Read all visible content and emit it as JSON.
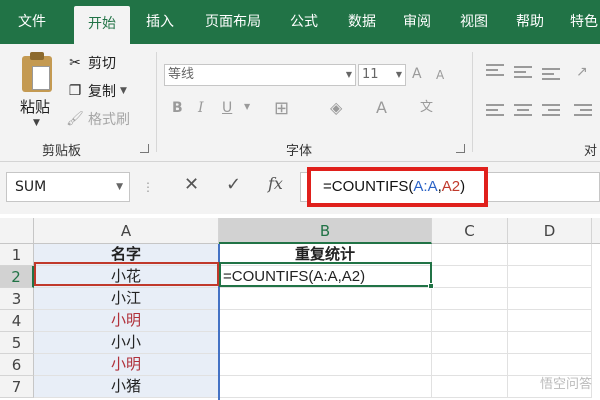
{
  "ribbon_tabs": [
    "文件",
    "开始",
    "插入",
    "页面布局",
    "公式",
    "数据",
    "审阅",
    "视图",
    "帮助",
    "特色"
  ],
  "active_tab": "开始",
  "clipboard": {
    "paste": "粘贴",
    "cut": "剪切",
    "copy": "复制",
    "format_painter": "格式刷",
    "group_label": "剪贴板"
  },
  "font": {
    "family": "等线",
    "size": "11",
    "group_label": "字体",
    "bold": "B",
    "italic": "I",
    "underline": "U",
    "grow": "A",
    "shrink": "A",
    "color": "A"
  },
  "alignment": {
    "group_label": "对齐"
  },
  "formula_bar": {
    "name_box": "SUM",
    "fx": "fx",
    "formula_prefix": "=COUNTIFS(",
    "formula_ref1": "A:A",
    "formula_comma": ",",
    "formula_ref2": "A2",
    "formula_suffix": ")"
  },
  "sheet": {
    "columns": [
      "A",
      "B",
      "C",
      "D"
    ],
    "rows": [
      "1",
      "2",
      "3",
      "4",
      "5",
      "6",
      "7"
    ],
    "col_a": [
      "名字",
      "小花",
      "小江",
      "小明",
      "小小",
      "小明",
      "小猪"
    ],
    "col_b": [
      "重复统计",
      "=COUNTIFS(A:A,A2)",
      "",
      "",
      "",
      "",
      ""
    ],
    "active_cell": "B2"
  },
  "watermark": "悟空问答"
}
